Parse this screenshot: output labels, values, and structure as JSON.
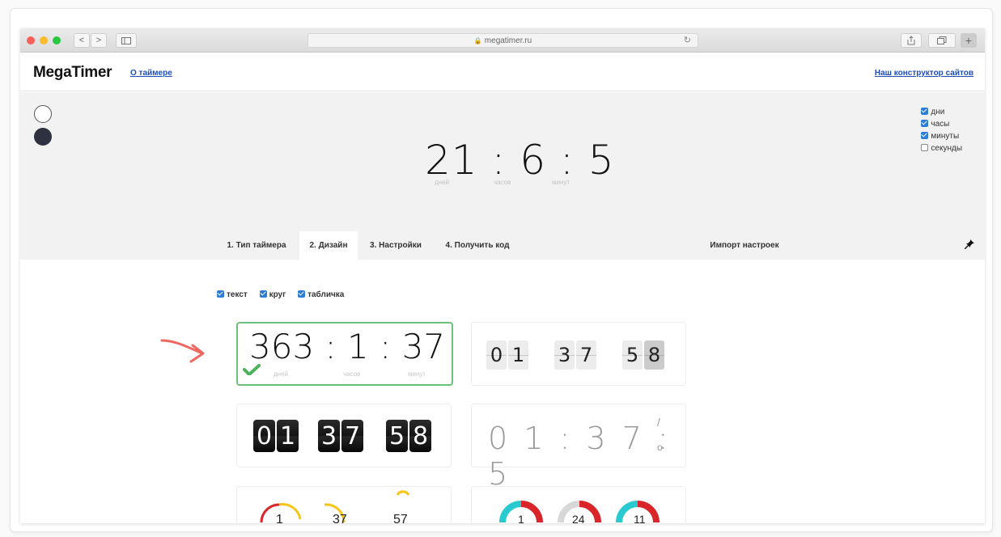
{
  "browser": {
    "url": "megatimer.ru",
    "back_label": "<",
    "forward_label": ">"
  },
  "header": {
    "logo": "MegaTimer",
    "about_link": "О таймере",
    "constructor_link": "Наш конструктор сайтов"
  },
  "preview": {
    "timer_text": "21 : 6 : 5",
    "units": [
      "дней",
      "часов",
      "минут"
    ],
    "display_options": [
      {
        "label": "дни",
        "checked": true
      },
      {
        "label": "часы",
        "checked": true
      },
      {
        "label": "минуты",
        "checked": true
      },
      {
        "label": "секунды",
        "checked": false
      }
    ]
  },
  "tabs": [
    {
      "label": "1. Тип таймера",
      "active": false
    },
    {
      "label": "2. Дизайн",
      "active": true
    },
    {
      "label": "3. Настройки",
      "active": false
    },
    {
      "label": "4. Получить код",
      "active": false
    }
  ],
  "import_label": "Импорт настроек",
  "design": {
    "element_options": [
      {
        "label": "текст",
        "checked": true
      },
      {
        "label": "круг",
        "checked": true
      },
      {
        "label": "табличка",
        "checked": true
      }
    ],
    "card1": {
      "text": "363 : 1 : 37",
      "units": [
        "дней",
        "часов",
        "минут"
      ]
    },
    "card2": {
      "groups": [
        [
          "0",
          "1"
        ],
        [
          "3",
          "7"
        ],
        [
          "5",
          "8"
        ]
      ]
    },
    "card3": {
      "groups": [
        [
          "0",
          "1"
        ],
        [
          "3",
          "7"
        ],
        [
          "5",
          "8"
        ]
      ]
    },
    "card4": {
      "text": "0 1 : 3 7 : 5",
      "tail_top": "/",
      "tail_bottom": "o"
    },
    "card5": {
      "values": [
        "1",
        "37",
        "57"
      ]
    },
    "card6": {
      "values": [
        "1",
        "24",
        "11"
      ]
    }
  },
  "colors": {
    "accent_blue": "#1f4db8",
    "checkbox_blue": "#2d7cd6",
    "selected_green": "#6cc07a",
    "arrow_red": "#f0675f",
    "ring_red": "#d9252a",
    "ring_cyan": "#29c9d0",
    "ring_yellow": "#f5c518"
  }
}
